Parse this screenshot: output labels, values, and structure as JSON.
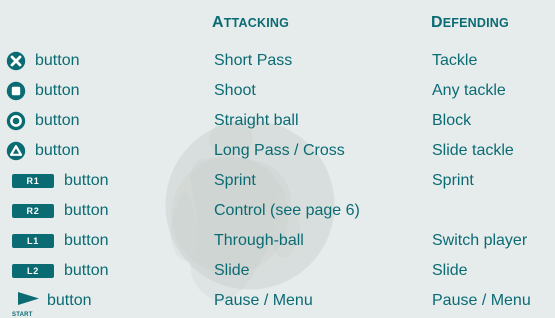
{
  "headers": {
    "attacking": {
      "first": "A",
      "rest": "TTACKING"
    },
    "defending": {
      "first": "D",
      "rest": "EFENDING"
    }
  },
  "rows": [
    {
      "icon": "cross-icon",
      "control": "button",
      "attacking": "Short Pass",
      "defending": "Tackle"
    },
    {
      "icon": "square-icon",
      "control": "button",
      "attacking": "Shoot",
      "defending": "Any tackle"
    },
    {
      "icon": "circle-icon",
      "control": "button",
      "attacking": "Straight ball",
      "defending": "Block"
    },
    {
      "icon": "triangle-icon",
      "control": "button",
      "attacking": "Long Pass / Cross",
      "defending": "Slide tackle"
    },
    {
      "icon": "r1-icon",
      "icon_text": "R1",
      "control": "button",
      "attacking": "Sprint",
      "defending": "Sprint"
    },
    {
      "icon": "r2-icon",
      "icon_text": "R2",
      "control": "button",
      "attacking": "Control (see page 6)",
      "defending": ""
    },
    {
      "icon": "l1-icon",
      "icon_text": "L1",
      "control": "button",
      "attacking": "Through-ball",
      "defending": "Switch player"
    },
    {
      "icon": "l2-icon",
      "icon_text": "L2",
      "control": "button",
      "attacking": "Slide",
      "defending": "Slide"
    },
    {
      "icon": "start-icon",
      "icon_text": "START",
      "control": "button",
      "attacking": "Pause / Menu",
      "defending": "Pause / Menu"
    }
  ],
  "colors": {
    "text": "#0b6b73",
    "background": "#e6ecec"
  }
}
